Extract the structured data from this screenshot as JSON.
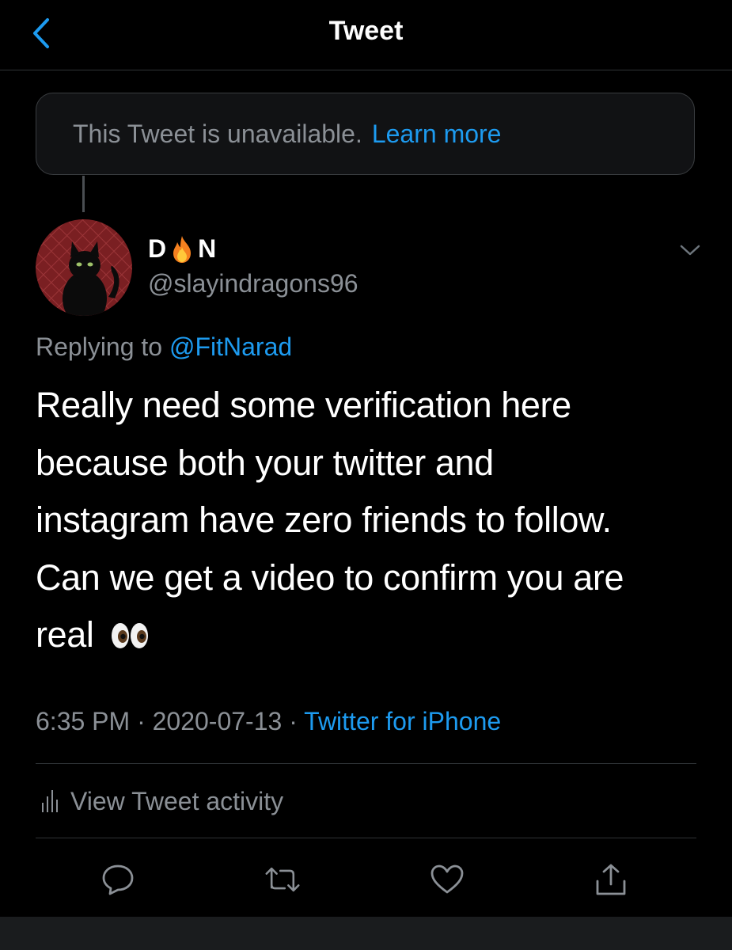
{
  "header": {
    "title": "Tweet",
    "back_icon": "chevron-left-icon"
  },
  "unavailable_notice": {
    "text": "This Tweet is unavailable.",
    "link": "Learn more"
  },
  "tweet": {
    "display_name_start": "D",
    "display_name_emoji": "fire-emoji",
    "display_name_end": "N",
    "handle": "@slayindragons96",
    "replying_prefix": "Replying to",
    "replying_to": "@FitNarad",
    "text_lines": [
      "Really need some verification here",
      "because both your twitter and",
      "instagram have zero friends to follow.",
      "Can we get a video to confirm you are",
      "real"
    ],
    "text_emoji": "eyes-emoji",
    "time": "6:35 PM",
    "separator": "·",
    "date": "2020-07-13",
    "client": "Twitter for iPhone"
  },
  "activity": {
    "label": "View Tweet activity",
    "icon": "stats-icon"
  },
  "actions": [
    {
      "name": "reply",
      "icon": "comment-icon"
    },
    {
      "name": "retweet",
      "icon": "retweet-icon"
    },
    {
      "name": "like",
      "icon": "heart-icon"
    },
    {
      "name": "share",
      "icon": "share-icon"
    }
  ],
  "colors": {
    "background": "#000000",
    "accent": "#1d9bf0",
    "secondary_text": "#8b9096",
    "primary_text": "#ffffff",
    "divider": "#2f3336"
  }
}
